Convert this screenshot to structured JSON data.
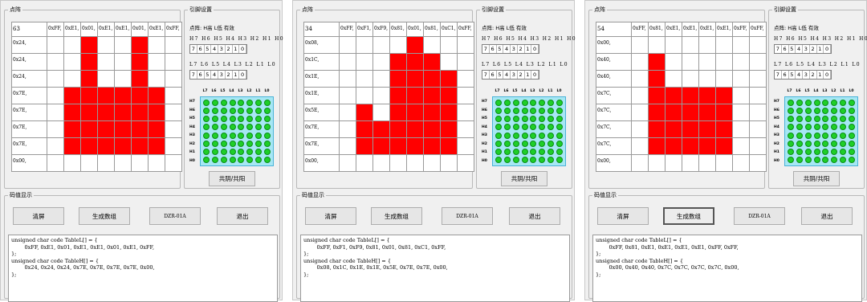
{
  "labels": {
    "dot_group": "点阵",
    "pin_group": "引脚设置",
    "code_group": "码值显示",
    "pin_desc": "点阵: H高 L低 有效",
    "h_header": "H7 H6 H5 H4 H3 H2 H1 H0",
    "l_header": "L7 L6 L5 L4 L3 L2 L1 L0",
    "pin_values": [
      "7",
      "6",
      "5",
      "4",
      "3",
      "2",
      "1",
      "0"
    ],
    "led_cols": [
      "L7",
      "L6",
      "L5",
      "L4",
      "L3",
      "L2",
      "L1",
      "L0"
    ],
    "led_rows": [
      "H7",
      "H6",
      "H5",
      "H4",
      "H3",
      "H2",
      "H1",
      "H0"
    ],
    "mode_button": "共阴/共阳",
    "clear_button": "清屏",
    "gen_button": "生成数组",
    "dzr_button": "DZR-01A",
    "exit_button": "退出"
  },
  "colors": {
    "lit_cell": "#ff0000",
    "led_on": "#1ecf28",
    "led_panel": "#a6e7f4"
  },
  "panels": [
    {
      "corner": "63",
      "col_headers": [
        "0xFF,",
        "0xE1,",
        "0x01,",
        "0xE1,",
        "0xE1,",
        "0x01,",
        "0xE1,",
        "0xFF,"
      ],
      "row_headers": [
        "0x24,",
        "0x24,",
        "0x24,",
        "0x7E,",
        "0x7E,",
        "0x7E,",
        "0x7E,",
        "0x00,"
      ],
      "matrix": [
        [
          0,
          0,
          1,
          0,
          0,
          1,
          0,
          0
        ],
        [
          0,
          0,
          1,
          0,
          0,
          1,
          0,
          0
        ],
        [
          0,
          0,
          1,
          0,
          0,
          1,
          0,
          0
        ],
        [
          0,
          1,
          1,
          1,
          1,
          1,
          1,
          0
        ],
        [
          0,
          1,
          1,
          1,
          1,
          1,
          1,
          0
        ],
        [
          0,
          1,
          1,
          1,
          1,
          1,
          1,
          0
        ],
        [
          0,
          1,
          1,
          1,
          1,
          1,
          1,
          0
        ],
        [
          0,
          0,
          0,
          0,
          0,
          0,
          0,
          0
        ]
      ],
      "gen_focused": false,
      "code": "unsigned char code TableL[] = {\n        0xFF, 0xE1, 0x01, 0xE1, 0xE1, 0x01, 0xE1, 0xFF,\n};\nunsigned char code TableH[] = {\n        0x24, 0x24, 0x24, 0x7E, 0x7E, 0x7E, 0x7E, 0x00,\n};"
    },
    {
      "corner": "34",
      "col_headers": [
        "0xFF,",
        "0xF1,",
        "0xF9,",
        "0x81,",
        "0x01,",
        "0x81,",
        "0xC1,",
        "0xFF,"
      ],
      "row_headers": [
        "0x08,",
        "0x1C,",
        "0x1E,",
        "0x1E,",
        "0x5E,",
        "0x7E,",
        "0x7E,",
        "0x00,"
      ],
      "matrix": [
        [
          0,
          0,
          0,
          0,
          1,
          0,
          0,
          0
        ],
        [
          0,
          0,
          0,
          1,
          1,
          1,
          0,
          0
        ],
        [
          0,
          0,
          0,
          1,
          1,
          1,
          1,
          0
        ],
        [
          0,
          0,
          0,
          1,
          1,
          1,
          1,
          0
        ],
        [
          0,
          1,
          0,
          1,
          1,
          1,
          1,
          0
        ],
        [
          0,
          1,
          1,
          1,
          1,
          1,
          1,
          0
        ],
        [
          0,
          1,
          1,
          1,
          1,
          1,
          1,
          0
        ],
        [
          0,
          0,
          0,
          0,
          0,
          0,
          0,
          0
        ]
      ],
      "gen_focused": false,
      "code": "unsigned char code TableL[] = {\n        0xFF, 0xF1, 0xF9, 0x81, 0x01, 0x81, 0xC1, 0xFF,\n};\nunsigned char code TableH[] = {\n        0x08, 0x1C, 0x1E, 0x1E, 0x5E, 0x7E, 0x7E, 0x00,\n};"
    },
    {
      "corner": "54",
      "col_headers": [
        "0xFF,",
        "0x81,",
        "0xE1,",
        "0xE1,",
        "0xE1,",
        "0xE1,",
        "0xFF,",
        "0xFF,"
      ],
      "row_headers": [
        "0x00,",
        "0x40,",
        "0x40,",
        "0x7C,",
        "0x7C,",
        "0x7C,",
        "0x7C,",
        "0x00,"
      ],
      "matrix": [
        [
          0,
          0,
          0,
          0,
          0,
          0,
          0,
          0
        ],
        [
          0,
          1,
          0,
          0,
          0,
          0,
          0,
          0
        ],
        [
          0,
          1,
          0,
          0,
          0,
          0,
          0,
          0
        ],
        [
          0,
          1,
          1,
          1,
          1,
          1,
          0,
          0
        ],
        [
          0,
          1,
          1,
          1,
          1,
          1,
          0,
          0
        ],
        [
          0,
          1,
          1,
          1,
          1,
          1,
          0,
          0
        ],
        [
          0,
          1,
          1,
          1,
          1,
          1,
          0,
          0
        ],
        [
          0,
          0,
          0,
          0,
          0,
          0,
          0,
          0
        ]
      ],
      "gen_focused": true,
      "code": "unsigned char code TableL[] = {\n        0xFF, 0x81, 0xE1, 0xE1, 0xE1, 0xE1, 0xFF, 0xFF,\n};\nunsigned char code TableH[] = {\n        0x00, 0x40, 0x40, 0x7C, 0x7C, 0x7C, 0x7C, 0x00,\n};"
    }
  ]
}
